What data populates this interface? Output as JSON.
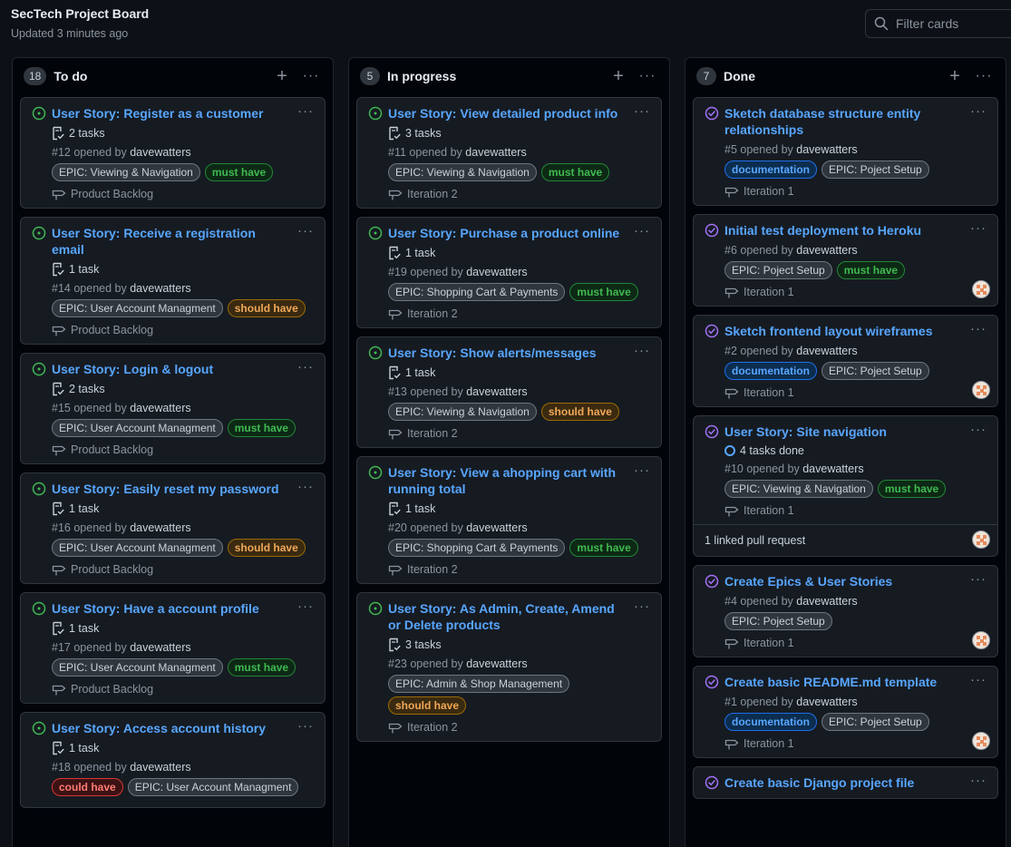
{
  "header": {
    "title": "SecTech Project Board",
    "updated": "Updated 3 minutes ago"
  },
  "filter": {
    "placeholder": "Filter cards",
    "value": ""
  },
  "columns": [
    {
      "name": "To do",
      "count": "18",
      "cards": [
        {
          "title": "User Story: Register as a customer",
          "tasks": "2 tasks",
          "number": "#12",
          "opened": "opened by",
          "user": "davewatters",
          "labels": [
            {
              "text": "EPIC: Viewing & Navigation",
              "kind": "epic"
            },
            {
              "text": "must have",
              "kind": "must"
            }
          ],
          "iteration": "Product Backlog"
        },
        {
          "title": "User Story: Receive a registration email",
          "tasks": "1 task",
          "number": "#14",
          "opened": "opened by",
          "user": "davewatters",
          "labels": [
            {
              "text": "EPIC: User Account Managment",
              "kind": "epic"
            },
            {
              "text": "should have",
              "kind": "should"
            }
          ],
          "iteration": "Product Backlog"
        },
        {
          "title": "User Story: Login & logout",
          "tasks": "2 tasks",
          "number": "#15",
          "opened": "opened by",
          "user": "davewatters",
          "labels": [
            {
              "text": "EPIC: User Account Managment",
              "kind": "epic"
            },
            {
              "text": "must have",
              "kind": "must"
            }
          ],
          "iteration": "Product Backlog"
        },
        {
          "title": "User Story: Easily reset my password",
          "tasks": "1 task",
          "number": "#16",
          "opened": "opened by",
          "user": "davewatters",
          "labels": [
            {
              "text": "EPIC: User Account Managment",
              "kind": "epic"
            },
            {
              "text": "should have",
              "kind": "should"
            }
          ],
          "iteration": "Product Backlog"
        },
        {
          "title": "User Story: Have a account profile",
          "tasks": "1 task",
          "number": "#17",
          "opened": "opened by",
          "user": "davewatters",
          "labels": [
            {
              "text": "EPIC: User Account Managment",
              "kind": "epic"
            },
            {
              "text": "must have",
              "kind": "must"
            }
          ],
          "iteration": "Product Backlog"
        },
        {
          "title": "User Story: Access account history",
          "tasks": "1 task",
          "number": "#18",
          "opened": "opened by",
          "user": "davewatters",
          "labels": [
            {
              "text": "could have",
              "kind": "could"
            },
            {
              "text": "EPIC: User Account Managment",
              "kind": "epic"
            }
          ],
          "iteration": ""
        }
      ]
    },
    {
      "name": "In progress",
      "count": "5",
      "cards": [
        {
          "title": "User Story: View detailed product info",
          "tasks": "3 tasks",
          "number": "#11",
          "opened": "opened by",
          "user": "davewatters",
          "labels": [
            {
              "text": "EPIC: Viewing & Navigation",
              "kind": "epic"
            },
            {
              "text": "must have",
              "kind": "must"
            }
          ],
          "iteration": "Iteration 2"
        },
        {
          "title": "User Story: Purchase a product online",
          "tasks": "1 task",
          "number": "#19",
          "opened": "opened by",
          "user": "davewatters",
          "labels": [
            {
              "text": "EPIC: Shopping Cart & Payments",
              "kind": "epic"
            },
            {
              "text": "must have",
              "kind": "must"
            }
          ],
          "iteration": "Iteration 2"
        },
        {
          "title": "User Story: Show alerts/messages",
          "tasks": "1 task",
          "number": "#13",
          "opened": "opened by",
          "user": "davewatters",
          "labels": [
            {
              "text": "EPIC: Viewing & Navigation",
              "kind": "epic"
            },
            {
              "text": "should have",
              "kind": "should"
            }
          ],
          "iteration": "Iteration 2"
        },
        {
          "title": "User Story: View a ahopping cart with running total",
          "tasks": "1 task",
          "number": "#20",
          "opened": "opened by",
          "user": "davewatters",
          "labels": [
            {
              "text": "EPIC: Shopping Cart & Payments",
              "kind": "epic"
            },
            {
              "text": "must have",
              "kind": "must"
            }
          ],
          "iteration": "Iteration 2"
        },
        {
          "title": "User Story: As Admin, Create, Amend or Delete products",
          "tasks": "3 tasks",
          "number": "#23",
          "opened": "opened by",
          "user": "davewatters",
          "labels": [
            {
              "text": "EPIC: Admin & Shop Management",
              "kind": "epic"
            },
            {
              "text": "should have",
              "kind": "should"
            }
          ],
          "iteration": "Iteration 2"
        }
      ]
    },
    {
      "name": "Done",
      "count": "7",
      "cards": [
        {
          "title": "Sketch database structure entity relationships",
          "tasks": "",
          "number": "#5",
          "opened": "opened by",
          "user": "davewatters",
          "labels": [
            {
              "text": "documentation",
              "kind": "doc"
            },
            {
              "text": "EPIC: Poject Setup",
              "kind": "epic"
            }
          ],
          "iteration": "Iteration 1",
          "avatar": false
        },
        {
          "title": "Initial test deployment to Heroku",
          "tasks": "",
          "number": "#6",
          "opened": "opened by",
          "user": "davewatters",
          "labels": [
            {
              "text": "EPIC: Poject Setup",
              "kind": "epic"
            },
            {
              "text": "must have",
              "kind": "must"
            }
          ],
          "iteration": "Iteration 1",
          "avatar": true
        },
        {
          "title": "Sketch frontend layout wireframes",
          "tasks": "",
          "number": "#2",
          "opened": "opened by",
          "user": "davewatters",
          "labels": [
            {
              "text": "documentation",
              "kind": "doc"
            },
            {
              "text": "EPIC: Poject Setup",
              "kind": "epic"
            }
          ],
          "iteration": "Iteration 1",
          "avatar": true
        },
        {
          "title": "User Story: Site navigation",
          "tasks_done": "4 tasks done",
          "number": "#10",
          "opened": "opened by",
          "user": "davewatters",
          "labels": [
            {
              "text": "EPIC: Viewing & Navigation",
              "kind": "epic"
            },
            {
              "text": "must have",
              "kind": "must"
            }
          ],
          "iteration": "Iteration 1",
          "avatar": true,
          "linked": "1 linked pull request"
        },
        {
          "title": "Create Epics & User Stories",
          "tasks": "",
          "number": "#4",
          "opened": "opened by",
          "user": "davewatters",
          "labels": [
            {
              "text": "EPIC: Poject Setup",
              "kind": "epic"
            }
          ],
          "iteration": "Iteration 1",
          "avatar": true
        },
        {
          "title": "Create basic README.md template",
          "tasks": "",
          "number": "#1",
          "opened": "opened by",
          "user": "davewatters",
          "labels": [
            {
              "text": "documentation",
              "kind": "doc"
            },
            {
              "text": "EPIC: Poject Setup",
              "kind": "epic"
            }
          ],
          "iteration": "Iteration 1",
          "avatar": true
        },
        {
          "title": "Create basic Django project file",
          "tasks": "",
          "number": "",
          "opened": "",
          "user": "",
          "labels": [],
          "iteration": "",
          "avatar": false
        }
      ]
    }
  ],
  "colors": {
    "link": "#58a6ff",
    "open": "#3fb950",
    "closed": "#a371f7"
  }
}
